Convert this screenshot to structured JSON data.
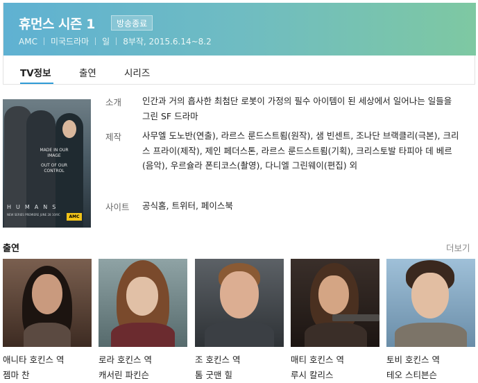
{
  "show": {
    "title": "휴먼스 시즌 1",
    "status_badge": "방송종료",
    "meta": [
      "AMC",
      "미국드라마",
      "일",
      "8부작, 2015.6.14~8.2"
    ]
  },
  "tabs": [
    {
      "label": "TV정보",
      "active": true
    },
    {
      "label": "출연",
      "active": false
    },
    {
      "label": "시리즈",
      "active": false
    }
  ],
  "poster": {
    "tagline_lines": [
      "MADE IN OUR",
      "IMAGE",
      "OUT OF OUR",
      "CONTROL"
    ],
    "brand": "HUMANS",
    "brand_sub": "NEW SERIES PREMIERE JUNE 28 10/9C",
    "network_logo": "AMC"
  },
  "info": {
    "intro_label": "소개",
    "intro": "인간과 거의 흡사한 최첨단 로봇이 가정의 필수 아이템이 된 세상에서 일어나는 일들을 그린 SF 드라마",
    "credits_label": "제작",
    "credits": "사무엘 도노반(연출), 라르스 룬드스트룀(원작), 샘 빈센트, 조나단 브랙클리(극본), 크리스 프라이(제작), 제인 페더스톤, 라르스 룬드스트룀(기획), 크리스토발 타피아 데 베르(음악), 우르슐라 폰티코스(촬영), 다니엘 그린웨이(편집) 외",
    "site_label": "사이트",
    "site_links": "공식홈, 트위터, 페이스북"
  },
  "cast": {
    "title": "출연",
    "more": "더보기",
    "members": [
      {
        "role": "애니타 호킨스 역",
        "name": "젬마 찬"
      },
      {
        "role": "로라 호킨스 역",
        "name": "캐서린 파킨슨"
      },
      {
        "role": "조 호킨스 역",
        "name": "톰 굿맨 힐"
      },
      {
        "role": "매티 호킨스 역",
        "name": "루시 칼리스"
      },
      {
        "role": "토비 호킨스 역",
        "name": "테오 스티븐슨"
      }
    ]
  },
  "colors": {
    "hero_gradient_start": "#5fb1d2",
    "hero_gradient_end": "#7ec8a2",
    "tab_accent": "#2f9bd6"
  }
}
